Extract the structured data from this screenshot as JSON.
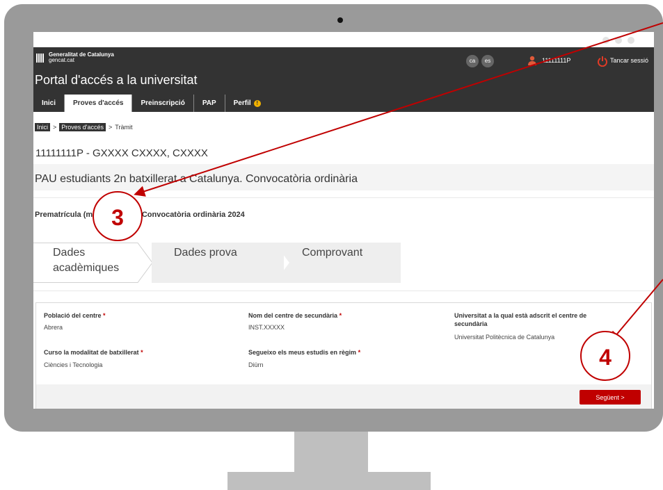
{
  "header": {
    "org_line1": "Generalitat de Catalunya",
    "org_line2": "gencat.cat",
    "lang_ca": "ca",
    "lang_es": "es",
    "user_id": "11111111P",
    "logout_label": "Tancar sessió",
    "portal_title": "Portal d'accés a la universitat"
  },
  "nav": {
    "items": [
      {
        "label": "Inici"
      },
      {
        "label": "Proves d'accés"
      },
      {
        "label": "Preinscripció"
      },
      {
        "label": "PAP"
      },
      {
        "label": "Perfil"
      }
    ],
    "warning_glyph": "!"
  },
  "breadcrumb": {
    "home": "Inici",
    "sep": ">",
    "section": "Proves d'accés",
    "current": "Tràmit"
  },
  "record_title": "11111111P - GXXXX CXXXX, CXXXX",
  "pau_title": "PAU estudiants 2n batxillerat a Catalunya. Convocatòria ordinària",
  "prematricula": "Prematrícula (matèries PAU). Convocatòria ordinària 2024",
  "steps": [
    {
      "line1": "Dades",
      "line2": "acadèmiques"
    },
    {
      "line1": "Dades prova"
    },
    {
      "line1": "Comprovant"
    }
  ],
  "form": {
    "required_mark": "*",
    "poblacio_label": "Població del centre",
    "poblacio_value": "Abrera",
    "centre_label": "Nom del centre de secundària",
    "centre_value": "INST.XXXXX",
    "univ_label_line1": "Universitat a la qual està adscrit el centre de",
    "univ_label_line2": "secundària",
    "univ_value": "Universitat Politècnica de Catalunya",
    "modalitat_label": "Curso la modalitat de batxillerat",
    "modalitat_value": "Ciències i Tecnologia",
    "regim_label": "Segueixo els meus estudis en règim",
    "regim_value": "Diürn"
  },
  "next_button": "Següent >",
  "callouts": {
    "three": "3",
    "four": "4"
  },
  "colors": {
    "accent": "#c00000",
    "header_bg": "#333333"
  }
}
